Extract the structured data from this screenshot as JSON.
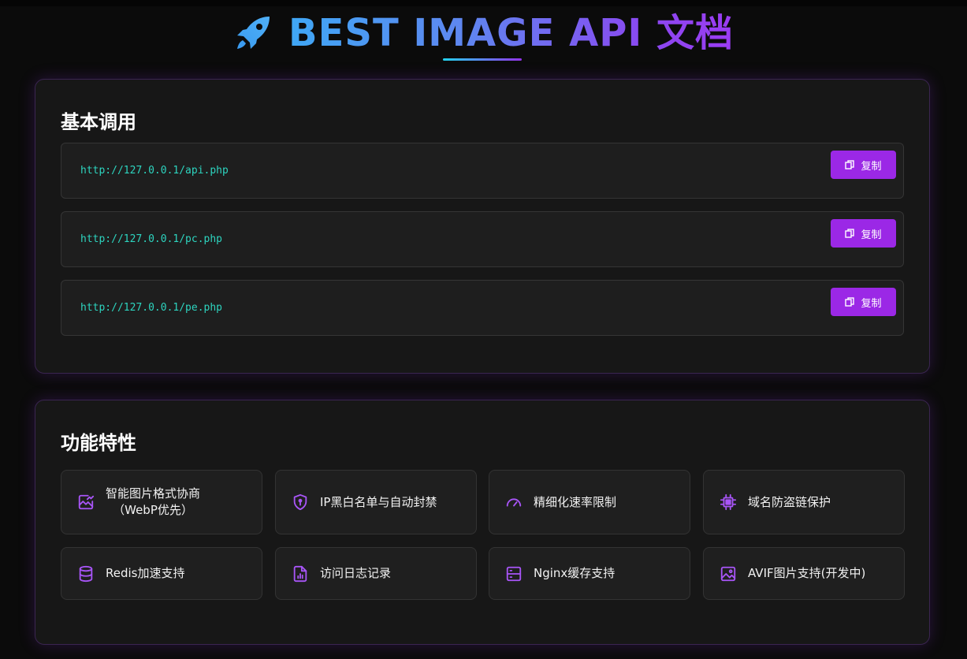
{
  "header": {
    "title": "BEST IMAGE API 文档",
    "icon": "rocket-icon",
    "gradient": [
      "#3fa7f5",
      "#9b3cf2"
    ]
  },
  "basic": {
    "title": "基本调用",
    "apis": [
      {
        "url": "http://127.0.0.1/api.php",
        "copy_label": "复制"
      },
      {
        "url": "http://127.0.0.1/pc.php",
        "copy_label": "复制"
      },
      {
        "url": "http://127.0.0.1/pe.php",
        "copy_label": "复制"
      }
    ]
  },
  "features": {
    "title": "功能特性",
    "items": [
      {
        "label": "智能图片格式协商",
        "label2": "（WebP优先）",
        "icon": "image-chart-icon"
      },
      {
        "label": "IP黑白名单与自动封禁",
        "icon": "shield-lock-icon"
      },
      {
        "label": "精细化速率限制",
        "icon": "gauge-icon"
      },
      {
        "label": "域名防盗链保护",
        "icon": "chip-icon"
      },
      {
        "label": "Redis加速支持",
        "icon": "database-icon"
      },
      {
        "label": "访问日志记录",
        "icon": "report-icon"
      },
      {
        "label": "Nginx缓存支持",
        "icon": "server-icon"
      },
      {
        "label": "AVIF图片支持(开发中)",
        "icon": "image-icon"
      }
    ]
  },
  "colors": {
    "accent": "#9b28e6",
    "url": "#2dd4bf",
    "icon": "#a855f7",
    "background": "#0b0b0b",
    "card": "#171717"
  }
}
